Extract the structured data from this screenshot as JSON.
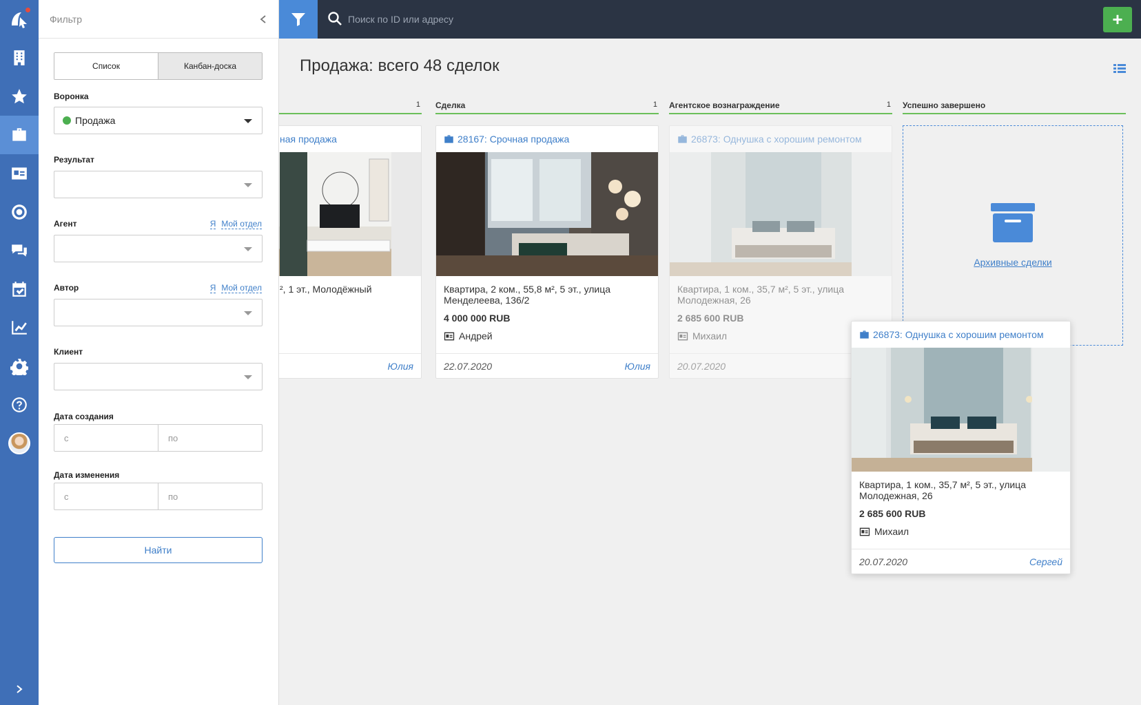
{
  "rail": {
    "items": [
      "buildings-icon",
      "star-icon",
      "briefcase-icon",
      "contact-card-icon",
      "target-icon",
      "chat-icon",
      "calendar-check-icon",
      "chart-icon",
      "gear-icon",
      "help-icon"
    ],
    "active": "briefcase-icon",
    "accent": "#3f6fb7"
  },
  "filter": {
    "title": "Фильтр",
    "view_list": "Список",
    "view_kanban": "Канбан-доска",
    "funnel_label": "Воронка",
    "funnel_value": "Продажа",
    "result_label": "Результат",
    "agent_label": "Агент",
    "author_label": "Автор",
    "link_me": "Я",
    "link_dept": "Мой отдел",
    "client_label": "Клиент",
    "created_label": "Дата создания",
    "changed_label": "Дата изменения",
    "from_placeholder": "с",
    "to_placeholder": "по",
    "find_button": "Найти"
  },
  "topbar": {
    "search_placeholder": "Поиск по ID или адресу",
    "add_label": "+"
  },
  "board": {
    "title": "Продажа: всего 48 сделок",
    "columns": [
      {
        "name": "",
        "count": "1"
      },
      {
        "name": "Сделка",
        "count": "1"
      },
      {
        "name": "Агентское вознаграждение",
        "count": "1"
      },
      {
        "name": "Успешно завершено",
        "count": ""
      }
    ],
    "archive_link": "Архивные сделки",
    "cards": [
      {
        "title": "ная продажа",
        "address": "², 1 эт., Молодёжный",
        "price": "",
        "agent": "",
        "date": "",
        "user": "Юлия"
      },
      {
        "title": "28167: Срочная продажа",
        "address": "Квартира, 2 ком., 55,8 м², 5 эт., улица Менделеева, 136/2",
        "price": "4 000 000 RUB",
        "agent": "Андрей",
        "date": "22.07.2020",
        "user": "Юлия"
      },
      {
        "title": "26873: Однушка с хорошим ремонтом",
        "address": "Квартира, 1 ком., 35,7 м², 5 эт., улица Молодежная, 26",
        "price": "2 685 600 RUB",
        "agent": "Михаил",
        "date": "20.07.2020",
        "user": ""
      },
      {
        "title": "26873: Однушка с хорошим ремонтом",
        "address": "Квартира, 1 ком., 35,7 м², 5 эт., улица Молодежная, 26",
        "price": "2 685 600 RUB",
        "agent": "Михаил",
        "date": "20.07.2020",
        "user": "Сергей"
      }
    ]
  }
}
